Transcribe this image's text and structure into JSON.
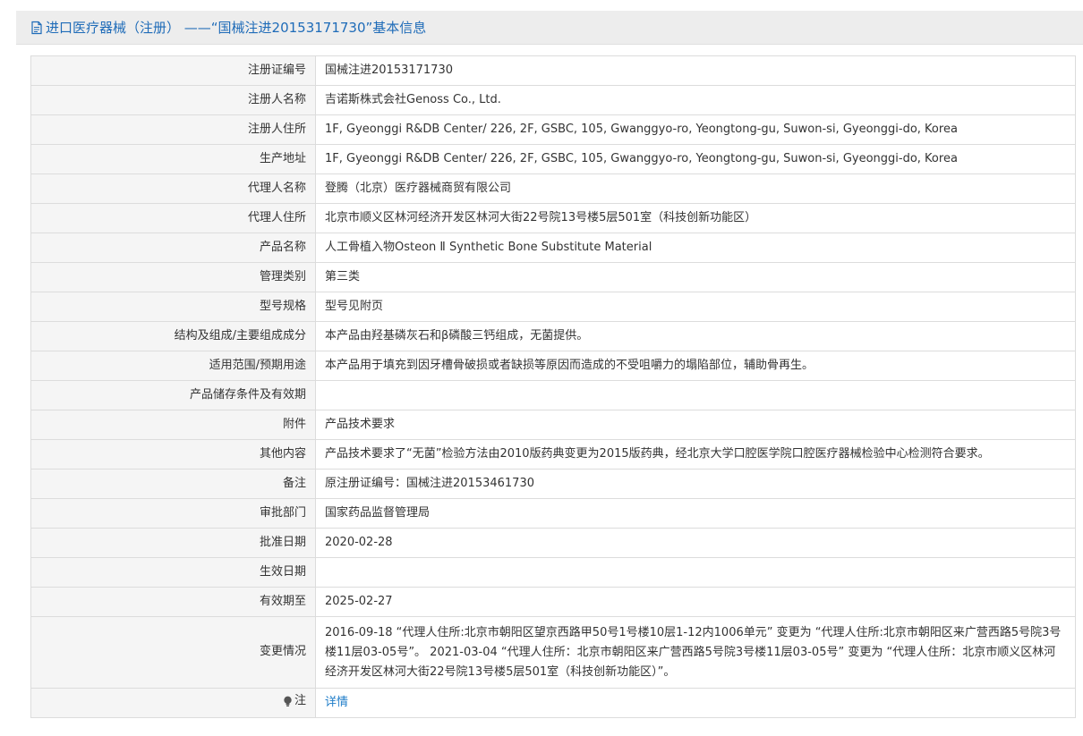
{
  "header": {
    "icon": "document-icon",
    "title": "进口医疗器械（注册） ——“国械注进20153171730”基本信息"
  },
  "rows": [
    {
      "label": "注册证编号",
      "value": "国械注进20153171730"
    },
    {
      "label": "注册人名称",
      "value": "吉诺斯株式会社Genoss Co., Ltd."
    },
    {
      "label": "注册人住所",
      "value": "1F, Gyeonggi R&DB Center/ 226, 2F, GSBC, 105, Gwanggyo-ro, Yeongtong-gu, Suwon-si, Gyeonggi-do, Korea"
    },
    {
      "label": "生产地址",
      "value": "1F, Gyeonggi R&DB Center/ 226, 2F, GSBC, 105, Gwanggyo-ro, Yeongtong-gu, Suwon-si, Gyeonggi-do, Korea"
    },
    {
      "label": "代理人名称",
      "value": "登腾（北京）医疗器械商贸有限公司"
    },
    {
      "label": "代理人住所",
      "value": "北京市顺义区林河经济开发区林河大街22号院13号楼5层501室（科技创新功能区）"
    },
    {
      "label": "产品名称",
      "value": "人工骨植入物Osteon Ⅱ Synthetic Bone Substitute Material"
    },
    {
      "label": "管理类别",
      "value": "第三类"
    },
    {
      "label": "型号规格",
      "value": "型号见附页"
    },
    {
      "label": "结构及组成/主要组成成分",
      "value": "本产品由羟基磷灰石和β磷酸三钙组成，无菌提供。"
    },
    {
      "label": "适用范围/预期用途",
      "value": "本产品用于填充到因牙槽骨破损或者缺损等原因而造成的不受咀嚼力的塌陷部位，辅助骨再生。"
    },
    {
      "label": "产品储存条件及有效期",
      "value": ""
    },
    {
      "label": "附件",
      "value": "产品技术要求"
    },
    {
      "label": "其他内容",
      "value": "产品技术要求了“无菌”检验方法由2010版药典变更为2015版药典，经北京大学口腔医学院口腔医疗器械检验中心检测符合要求。"
    },
    {
      "label": "备注",
      "value": "原注册证编号：国械注进20153461730"
    },
    {
      "label": "审批部门",
      "value": "国家药品监督管理局"
    },
    {
      "label": "批准日期",
      "value": "2020-02-28"
    },
    {
      "label": "生效日期",
      "value": ""
    },
    {
      "label": "有效期至",
      "value": "2025-02-27"
    },
    {
      "label": "变更情况",
      "value": "2016-09-18 “代理人住所:北京市朝阳区望京西路甲50号1号楼10层1-12内1006单元” 变更为 “代理人住所:北京市朝阳区来广营西路5号院3号楼11层03-05号”。 2021-03-04 “代理人住所：北京市朝阳区来广营西路5号院3号楼11层03-05号” 变更为 “代理人住所：北京市顺义区林河经济开发区林河大街22号院13号楼5层501室（科技创新功能区）”。"
    }
  ],
  "note": {
    "icon": "lightbulb-icon",
    "label": "注",
    "link_text": "详情"
  }
}
